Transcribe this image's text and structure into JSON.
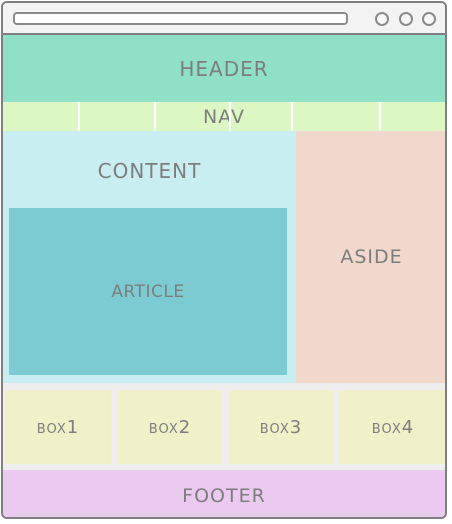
{
  "browser": {
    "address_value": "",
    "window_buttons": [
      "circle",
      "circle",
      "circle"
    ]
  },
  "layout_labels": {
    "header": "HEADER",
    "nav": "NAV",
    "content": "CONTENT",
    "article": "ARTICLE",
    "aside": "ASIDE",
    "boxes": [
      "box1",
      "box2",
      "box3",
      "box4"
    ],
    "footer": "FOOTER"
  },
  "colors": {
    "header": "#8fe0c6",
    "nav": "#dcf7c3",
    "content": "#c9eef2",
    "article": "#7ccbd2",
    "aside": "#f0d8cc",
    "box": "#f1f1c9",
    "footer": "#ebcaf0",
    "label_text": "#7d7d7d",
    "frame": "#7f7f7f"
  }
}
